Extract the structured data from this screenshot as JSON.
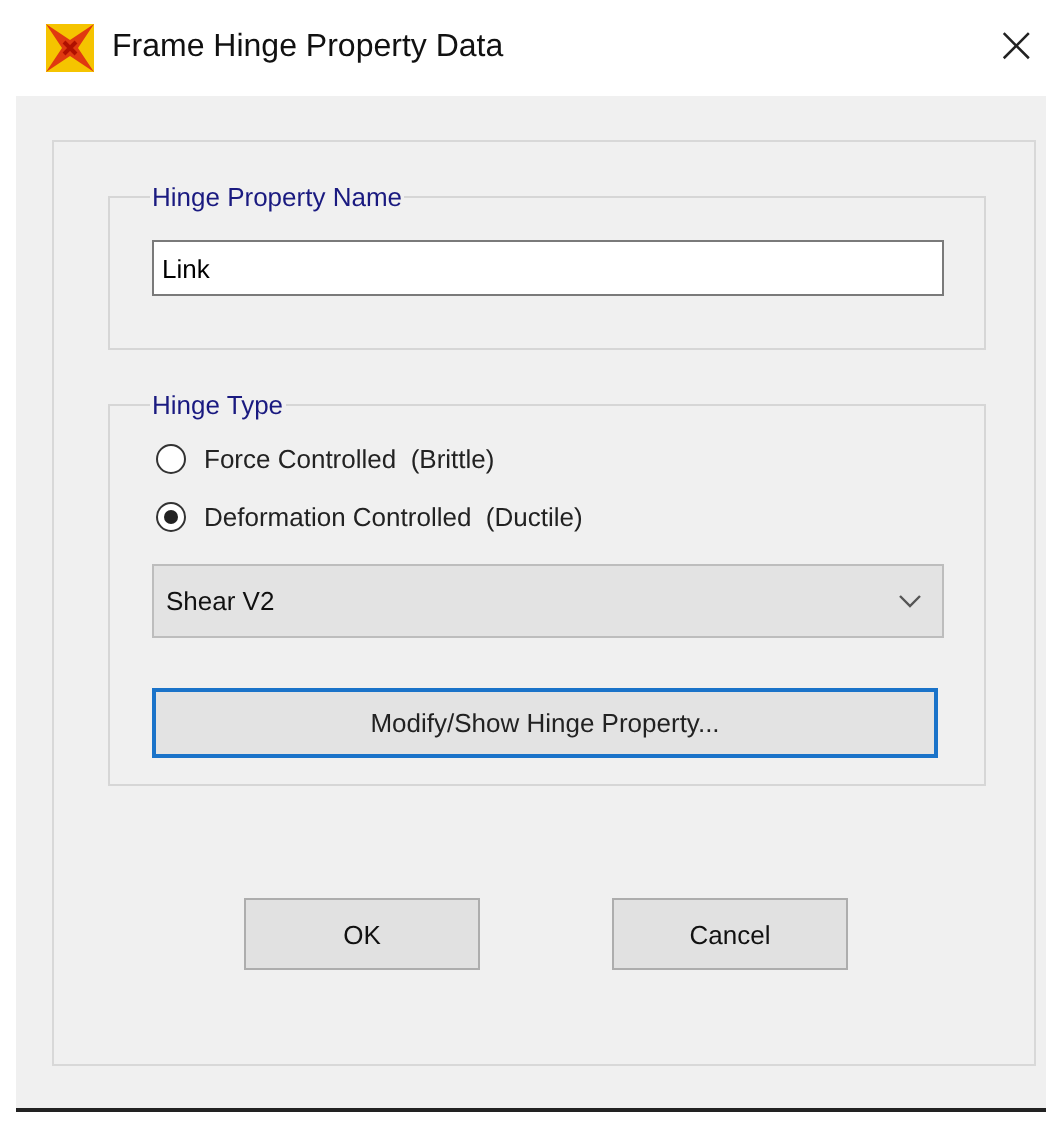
{
  "window": {
    "title": "Frame Hinge Property Data",
    "close": "×"
  },
  "name_group": {
    "title": "Hinge Property Name",
    "value": "Link"
  },
  "type_group": {
    "title": "Hinge Type",
    "options": [
      {
        "label": "Force Controlled  (Brittle)",
        "selected": false
      },
      {
        "label": "Deformation Controlled  (Ductile)",
        "selected": true
      }
    ],
    "dropdown": {
      "value": "Shear V2"
    },
    "modify_button": "Modify/Show Hinge Property..."
  },
  "buttons": [
    "OK",
    "Cancel"
  ]
}
